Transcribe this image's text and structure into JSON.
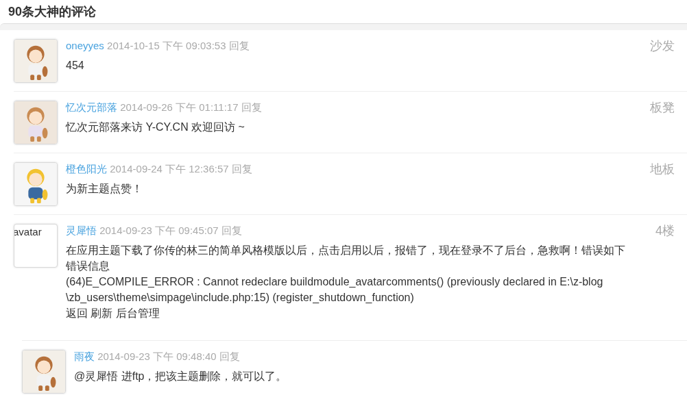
{
  "title": "90条大神的评论",
  "comments": [
    {
      "author": "oneyyes",
      "time": "2014-10-15 下午 09:03:53",
      "reply": "回复",
      "floor": "沙发",
      "body": [
        "454"
      ]
    },
    {
      "author": "忆次元部落",
      "time": "2014-09-26 下午 01:11:17",
      "reply": "回复",
      "floor": "板凳",
      "body": [
        "忆次元部落来访 Y-CY.CN 欢迎回访 ~"
      ]
    },
    {
      "author": "橙色阳光",
      "time": "2014-09-24 下午 12:36:57",
      "reply": "回复",
      "floor": "地板",
      "body": [
        "为新主题点赞！"
      ]
    },
    {
      "avatar": {
        "kind": "alt",
        "text": "avatar"
      },
      "author": "灵犀悟",
      "time": "2014-09-23 下午 09:45:07",
      "reply": "回复",
      "floor": "4楼",
      "body": [
        "在应用主题下载了你传的林三的简单风格模版以后，点击启用以后，报错了，现在登录不了后台，急救啊！错误如下",
        "错误信息",
        "(64)E_COMPILE_ERROR : Cannot redeclare buildmodule_avatarcomments() (previously declared in E:\\z-blog \\zb_users\\theme\\simpage\\include.php:15) (register_shutdown_function)",
        "返回 刷新 后台管理"
      ],
      "children": [
        {
          "author": "雨夜",
          "time": "2014-09-23 下午 09:48:40",
          "reply": "回复",
          "body": [
            "@灵犀悟 进ftp，把该主题删除，就可以了。"
          ]
        }
      ]
    }
  ]
}
